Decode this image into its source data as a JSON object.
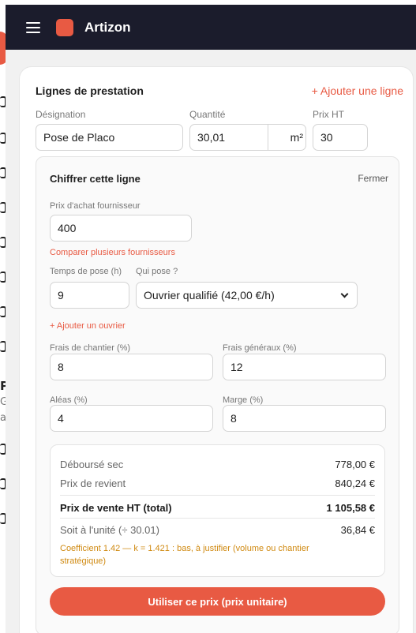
{
  "app": {
    "brand": "Artizon",
    "brand_color": "#e85a43",
    "topbar_color": "#1b1c2c"
  },
  "underlay": {
    "letter": "P",
    "small_1": "G",
    "small_2": "a"
  },
  "section": {
    "title": "Lignes de prestation",
    "add_line_label": "+ Ajouter une ligne"
  },
  "line": {
    "designation_label": "Désignation",
    "designation_value": "Pose de Placo",
    "quantity_label": "Quantité",
    "quantity_value": "30,01",
    "unit_value": "m²",
    "price_label": "Prix HT",
    "price_value": "30"
  },
  "costing": {
    "title": "Chiffrer cette ligne",
    "close_label": "Fermer",
    "supplier_price_label": "Prix d'achat fournisseur",
    "supplier_price_value": "400",
    "compare_link": "Comparer plusieurs fournisseurs",
    "labor_time_label": "Temps de pose (h)",
    "labor_time_value": "9",
    "who_label": "Qui pose ?",
    "who_value": "Ouvrier qualifié (42,00 €/h)",
    "add_worker_link": "+ Ajouter un ouvrier",
    "site_costs_label": "Frais de chantier (%)",
    "site_costs_value": "8",
    "overhead_label": "Frais généraux (%)",
    "overhead_value": "12",
    "risk_label": "Aléas (%)",
    "risk_value": "4",
    "margin_label": "Marge (%)",
    "margin_value": "8"
  },
  "summary": {
    "dry_cost_label": "Déboursé sec",
    "dry_cost_value": "778,00 €",
    "cost_price_label": "Prix de revient",
    "cost_price_value": "840,24 €",
    "sale_total_label": "Prix de vente HT (total)",
    "sale_total_value": "1 105,58 €",
    "unit_label": "Soit à l'unité (÷ 30.01)",
    "unit_value": "36,84 €",
    "warning": "Coefficient 1.42 — k = 1.421 : bas, à justifier (volume ou chantier stratégique)",
    "warning_color": "#d08a12"
  },
  "cta": {
    "label": "Utiliser ce prix (prix unitaire)"
  }
}
